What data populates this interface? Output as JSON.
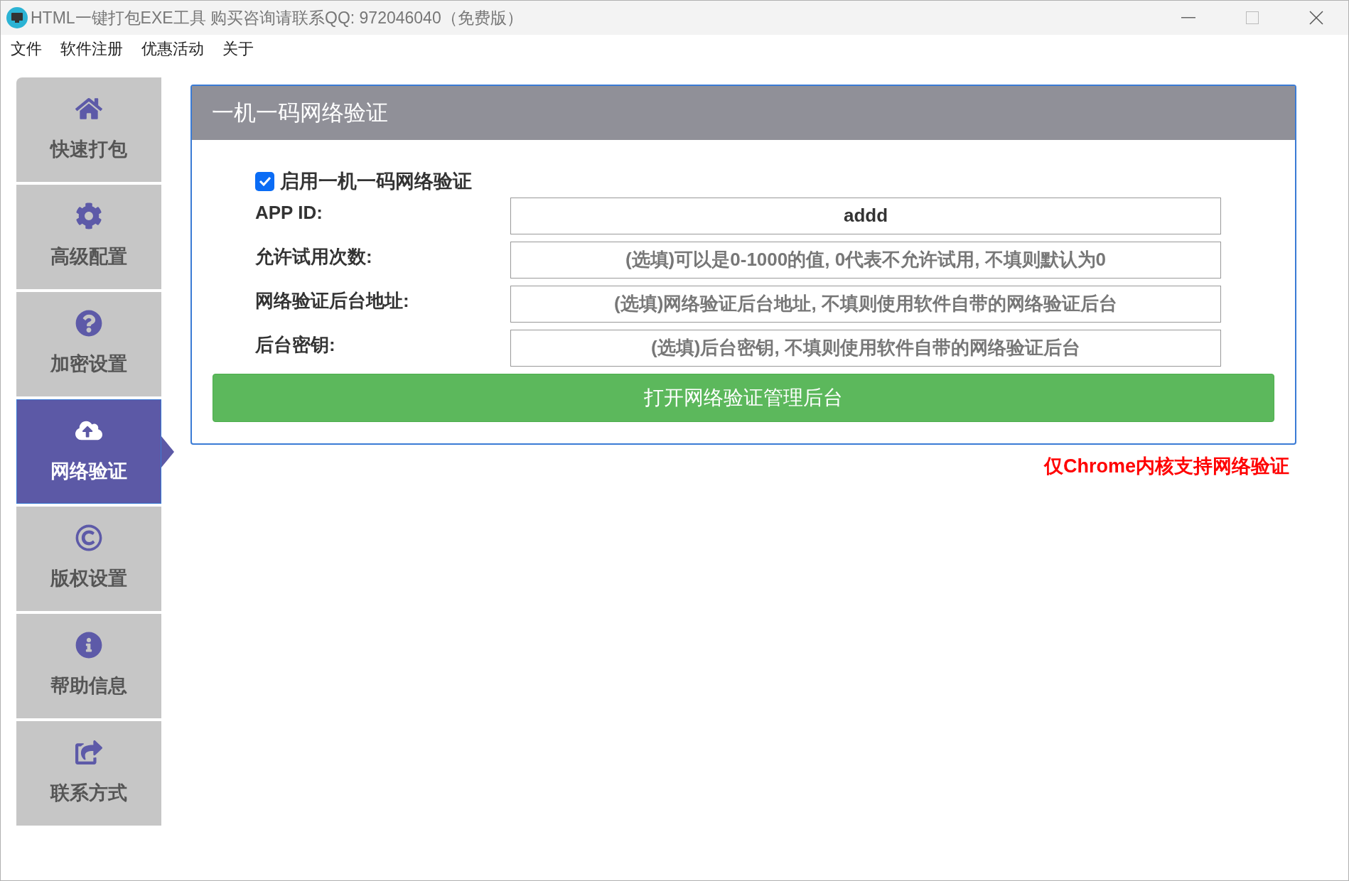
{
  "window": {
    "title": "HTML一键打包EXE工具 购买咨询请联系QQ: 972046040（免费版）"
  },
  "menu": [
    "文件",
    "软件注册",
    "优惠活动",
    "关于"
  ],
  "sidebar": {
    "items": [
      {
        "label": "快速打包",
        "selected": false
      },
      {
        "label": "高级配置",
        "selected": false
      },
      {
        "label": "加密设置",
        "selected": false
      },
      {
        "label": "网络验证",
        "selected": true
      },
      {
        "label": "版权设置",
        "selected": false
      },
      {
        "label": "帮助信息",
        "selected": false
      },
      {
        "label": "联系方式",
        "selected": false
      }
    ]
  },
  "panel": {
    "title": "一机一码网络验证",
    "enable": {
      "label": "启用一机一码网络验证",
      "checked": true
    },
    "fields": [
      {
        "label": "APP ID:",
        "value": "addd"
      },
      {
        "label": "允许试用次数:",
        "placeholder": "(选填)可以是0-1000的值, 0代表不允许试用, 不填则默认为0"
      },
      {
        "label": "网络验证后台地址:",
        "placeholder": "(选填)网络验证后台地址, 不填则使用软件自带的网络验证后台"
      },
      {
        "label": "后台密钥:",
        "placeholder": "(选填)后台密钥, 不填则使用软件自带的网络验证后台"
      }
    ],
    "button": "打开网络验证管理后台"
  },
  "note": "仅Chrome内核支持网络验证"
}
